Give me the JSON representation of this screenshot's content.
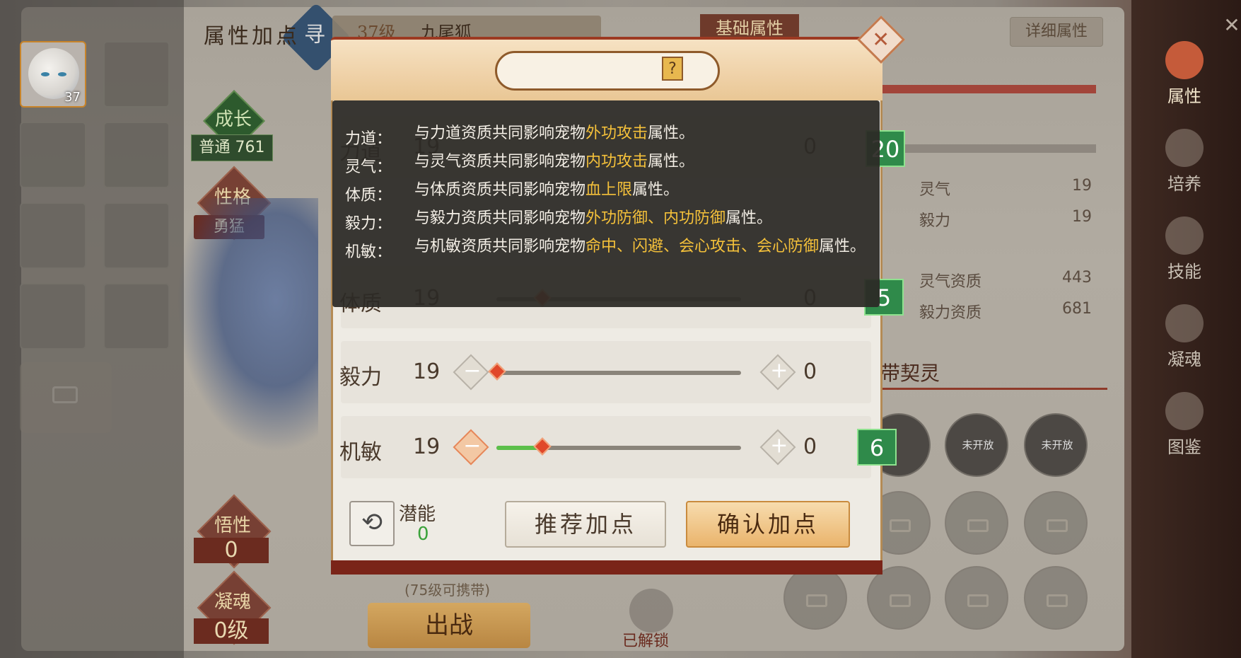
{
  "left": {
    "pet_level": "37",
    "growth_label": "成长",
    "growth_value": "普通 761",
    "personality_label": "性格",
    "personality_value": "勇猛",
    "comprehension_label": "悟性",
    "comprehension_value": "0",
    "soul_label": "凝魂",
    "soul_value": "0级"
  },
  "header": {
    "find_label": "寻",
    "level_text": "37级",
    "pet_name": "九尾狐",
    "basic_tab": "基础属性",
    "detail_button": "详细属性"
  },
  "right_stats": [
    {
      "label": "灵气",
      "value": "19"
    },
    {
      "label": "毅力",
      "value": "19"
    },
    {
      "label": "灵气资质",
      "value": "443"
    },
    {
      "label": "毅力资质",
      "value": "681"
    }
  ],
  "spirit": {
    "title": "带契灵",
    "slots": [
      "未开放",
      "未开放"
    ]
  },
  "bottom": {
    "carry_note": "(75级可携带)",
    "go_button": "出战",
    "unlocked_label": "已解锁"
  },
  "nav": [
    {
      "label": "属性",
      "active": true
    },
    {
      "label": "培养",
      "active": false
    },
    {
      "label": "技能",
      "active": false
    },
    {
      "label": "凝魂",
      "active": false
    },
    {
      "label": "图鉴",
      "active": false
    }
  ],
  "dialog": {
    "title": "属性加点",
    "help": "?",
    "rows": [
      {
        "name": "力道",
        "value": "19",
        "alloc": "0",
        "fill": 0.0,
        "thumb": 0.63,
        "flag": "20"
      },
      {
        "name": "体质",
        "value": "19",
        "alloc": "0",
        "fill": 0.0,
        "thumb": 0.18,
        "flag": "5"
      },
      {
        "name": "毅力",
        "value": "19",
        "alloc": "0",
        "fill": 0.0,
        "thumb": 0.0,
        "flag": ""
      },
      {
        "name": "机敏",
        "value": "19",
        "alloc": "0",
        "fill": 0.19,
        "thumb": 0.19,
        "flag": "6"
      }
    ],
    "potential_label": "潜能",
    "potential_value": "0",
    "recommend_button": "推荐加点",
    "confirm_button": "确认加点"
  },
  "tooltip": {
    "items": [
      {
        "label": "力道：",
        "pre": "与力道资质共同影响宠物",
        "hl": "外功攻击",
        "post": "属性。"
      },
      {
        "label": "灵气：",
        "pre": "与灵气资质共同影响宠物",
        "hl": "内功攻击",
        "post": "属性。"
      },
      {
        "label": "体质：",
        "pre": "与体质资质共同影响宠物",
        "hl": "血上限",
        "post": "属性。"
      },
      {
        "label": "毅力：",
        "pre": "与毅力资质共同影响宠物",
        "hl": "外功防御、内功防御",
        "post": "属性。"
      },
      {
        "label": "机敏：",
        "pre": "与机敏资质共同影响宠物",
        "hl": "命中、闪避、会心攻击、会心防御",
        "post": "属性。"
      }
    ]
  },
  "colors": {
    "accent_green": "#5cbf4a",
    "thumb_red": "#e0482a",
    "highlight_gold": "#f5c13a",
    "dialog_frame": "#b48b55"
  }
}
